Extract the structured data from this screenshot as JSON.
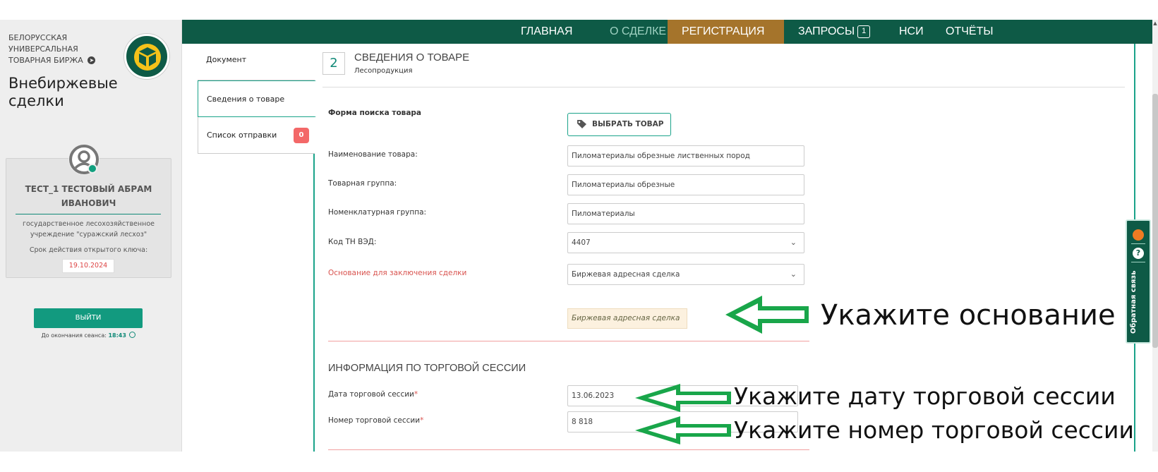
{
  "sidebar": {
    "org_name": "БЕЛОРУССКАЯ УНИВЕРСАЛЬНАЯ ТОВАРНАЯ БИРЖА",
    "app_title": "Внебиржевые сделки",
    "user_name": "ТЕСТ_1 ТЕСТОВЫЙ АБРАМ ИВАНОВИЧ",
    "user_org": "государственное лесохозяйственное учреждение \"суражский лесхоз\"",
    "key_label": "Срок действия открытого ключа:",
    "key_date": "19.10.2024",
    "logout_label": "ВЫЙТИ",
    "session_label": "До окончания сеанса:",
    "session_time": "18:43"
  },
  "nav": {
    "items": [
      "ГЛАВНАЯ",
      "О СДЕЛКЕ",
      "РЕГИСТРАЦИЯ",
      "ЗАПРОСЫ",
      "НСИ",
      "ОТЧЁТЫ"
    ],
    "requests_count": "1",
    "active": "РЕГИСТРАЦИЯ"
  },
  "tabs": {
    "document": "Документ",
    "goods": "Сведения о товаре",
    "shipment": "Список отправки",
    "shipment_count": "0"
  },
  "section": {
    "number": "2",
    "title": "СВЕДЕНИЯ О ТОВАРЕ",
    "subtitle": "Лесопродукция"
  },
  "form": {
    "search_label": "Форма поиска товара",
    "choose_button": "ВЫБРАТЬ ТОВАР",
    "name_label": "Наименование товара:",
    "name_value": "Пиломатериалы обрезные лиственных пород",
    "group_label": "Товарная группа:",
    "group_value": "Пиломатериалы обрезные",
    "nomen_label": "Номенклатурная группа:",
    "nomen_value": "Пиломатериалы",
    "tnved_label": "Код ТН ВЭД:",
    "tnved_value": "4407",
    "basis_label": "Основание для заключения сделки",
    "basis_value": "Биржевая адресная сделка",
    "basis_hint": "Биржевая адресная сделка"
  },
  "trade": {
    "title": "ИНФОРМАЦИЯ ПО ТОРГОВОЙ СЕССИИ",
    "date_label": "Дата торговой сессии",
    "date_value": "13.06.2023",
    "number_label": "Номер торговой сессии",
    "number_value": "8 818",
    "required_mark": "*"
  },
  "annotations": {
    "basis": "Укажите основание",
    "date": "Укажите дату торговой сессии",
    "number": "Укажите номер торговой сессии"
  },
  "feedback": {
    "label": "Обратная связь",
    "help": "?"
  },
  "colors": {
    "brand_dark": "#0e5a46",
    "accent_teal": "#1aa38a",
    "active_tab": "#a5742b",
    "arrow_green": "#19a64a",
    "required_red": "#d9534f"
  }
}
